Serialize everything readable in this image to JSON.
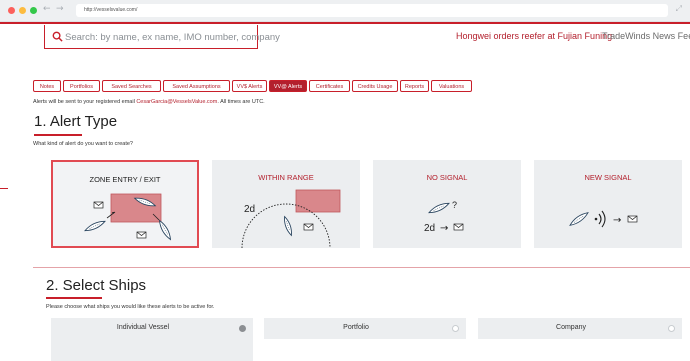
{
  "browser": {
    "url": "http://vesselsvalue.com/",
    "traffic_lights": [
      "#fc605c",
      "#fdbc40",
      "#34c84a"
    ]
  },
  "header": {
    "search_placeholder": "Search: by name, ex name, IMO number, company",
    "news_headline": "Hongwei orders reefer at Fujian Funing",
    "news_source": "TradeWinds News Feed"
  },
  "tabs": [
    {
      "label": "Notes",
      "active": false
    },
    {
      "label": "Portfolios",
      "active": false
    },
    {
      "label": "Saved Searches",
      "active": false
    },
    {
      "label": "Saved Assumptions",
      "active": false
    },
    {
      "label": "VV$ Alerts",
      "active": false
    },
    {
      "label": "VV@ Alerts",
      "active": true
    },
    {
      "label": "Certificates",
      "active": false
    },
    {
      "label": "Credits Usage",
      "active": false
    },
    {
      "label": "Reports",
      "active": false
    },
    {
      "label": "Valuations",
      "active": false
    }
  ],
  "alerts_note": {
    "prefix": "Alerts will be sent to your registered email ",
    "email": "CesarGarcia@VesselsValue.com",
    "suffix": ". All times are UTC."
  },
  "alert_type": {
    "heading": "1. Alert Type",
    "prompt": "What kind of alert do you want to create?",
    "cards": [
      {
        "title": "ZONE ENTRY / EXIT",
        "selected": true
      },
      {
        "title": "WITHIN RANGE",
        "selected": false,
        "range_label": "2d"
      },
      {
        "title": "NO SIGNAL",
        "selected": false,
        "question": "?",
        "duration": "2d",
        "arrow": "→"
      },
      {
        "title": "NEW SIGNAL",
        "selected": false,
        "arrow": "→"
      }
    ]
  },
  "select_ships": {
    "heading": "2. Select Ships",
    "prompt": "Please choose what ships you would like these alerts to be active for.",
    "options": [
      {
        "label": "Individual Vessel",
        "selected": true
      },
      {
        "label": "Portfolio",
        "selected": false
      },
      {
        "label": "Company",
        "selected": false
      }
    ]
  },
  "colors": {
    "brand_red": "#c81f2a",
    "zone_fill": "#d9878b",
    "card_bg": "#eceef0"
  }
}
